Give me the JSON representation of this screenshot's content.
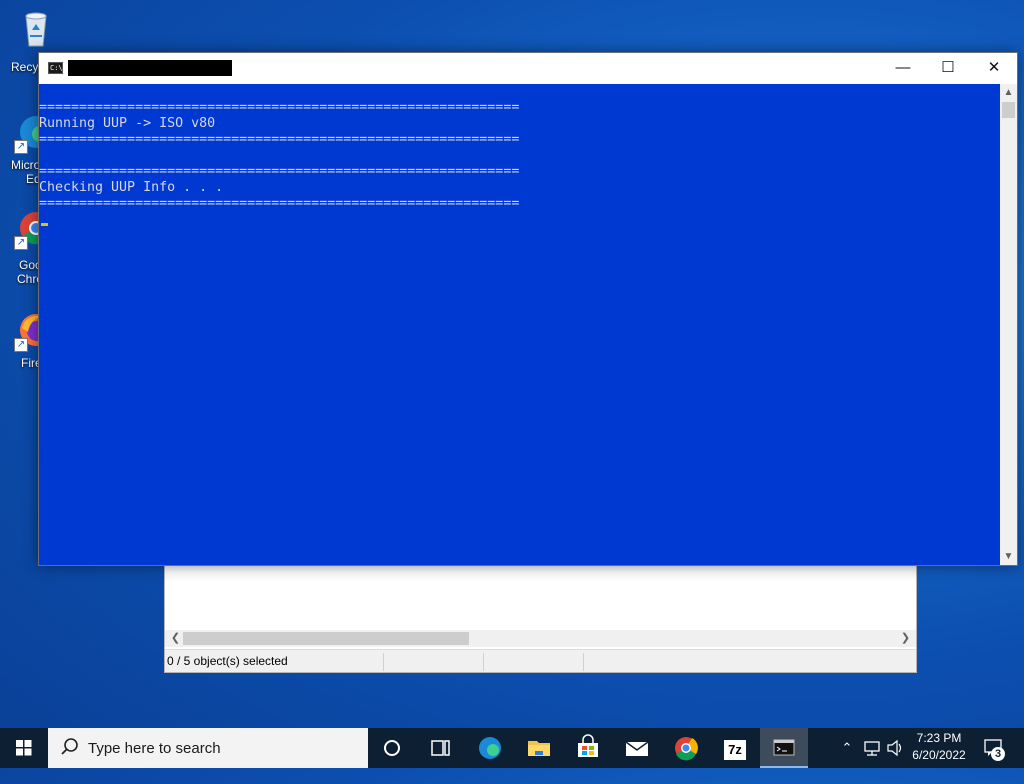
{
  "desktop": {
    "icons": [
      {
        "name": "recycle-bin",
        "label": "Recyc"
      },
      {
        "name": "edge-shortcut",
        "label_line1": "Micro",
        "label_line2": "Ed"
      },
      {
        "name": "chrome-shortcut",
        "label_line1": "Goo",
        "label_line2": "Chro"
      },
      {
        "name": "firefox-shortcut",
        "label_line1": "Fire"
      }
    ]
  },
  "explorer": {
    "status_text": "0 / 5 object(s) selected"
  },
  "console": {
    "minimize_glyph": "—",
    "maximize_glyph": "☐",
    "close_glyph": "✕",
    "lines": [
      "",
      "============================================================",
      "Running UUP -> ISO v80",
      "============================================================",
      "",
      "============================================================",
      "Checking UUP Info . . .",
      "============================================================"
    ],
    "background_color": "#0038d2"
  },
  "taskbar": {
    "search_placeholder": "Type here to search",
    "apps": [
      {
        "name": "cortana-icon"
      },
      {
        "name": "task-view-icon"
      },
      {
        "name": "edge-icon"
      },
      {
        "name": "file-explorer-icon"
      },
      {
        "name": "store-icon"
      },
      {
        "name": "mail-icon"
      },
      {
        "name": "chrome-icon"
      },
      {
        "name": "7zip-icon",
        "label": "7z"
      },
      {
        "name": "cmd-icon"
      }
    ],
    "clock_time": "7:23 PM",
    "clock_date": "6/20/2022",
    "notification_count": "3"
  }
}
